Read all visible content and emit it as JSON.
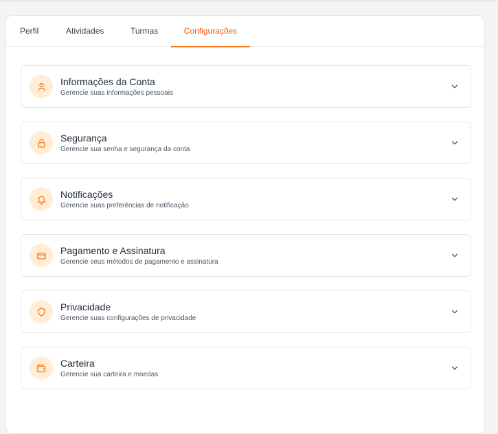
{
  "tabs": {
    "perfil": "Perfil",
    "atividades": "Atividades",
    "turmas": "Turmas",
    "configuracoes": "Configurações"
  },
  "sections": [
    {
      "title": "Informações da Conta",
      "description": "Gerencie suas informações pessoais",
      "icon": "user-icon"
    },
    {
      "title": "Segurança",
      "description": "Gerencie sua senha e segurança da conta",
      "icon": "lock-icon"
    },
    {
      "title": "Notificações",
      "description": "Gerencie suas preferências de notificação",
      "icon": "bell-icon"
    },
    {
      "title": "Pagamento e Assinatura",
      "description": "Gerencie seus métodos de pagamento e assinatura",
      "icon": "credit-card-icon"
    },
    {
      "title": "Privacidade",
      "description": "Gerencie suas configurações de privacidade",
      "icon": "shield-icon"
    },
    {
      "title": "Carteira",
      "description": "Gerencie sua carteira e moedas",
      "icon": "wallet-icon"
    }
  ],
  "colors": {
    "accent": "#f97316",
    "accent_text": "#ea580c",
    "icon_bg": "#ffedd5"
  }
}
